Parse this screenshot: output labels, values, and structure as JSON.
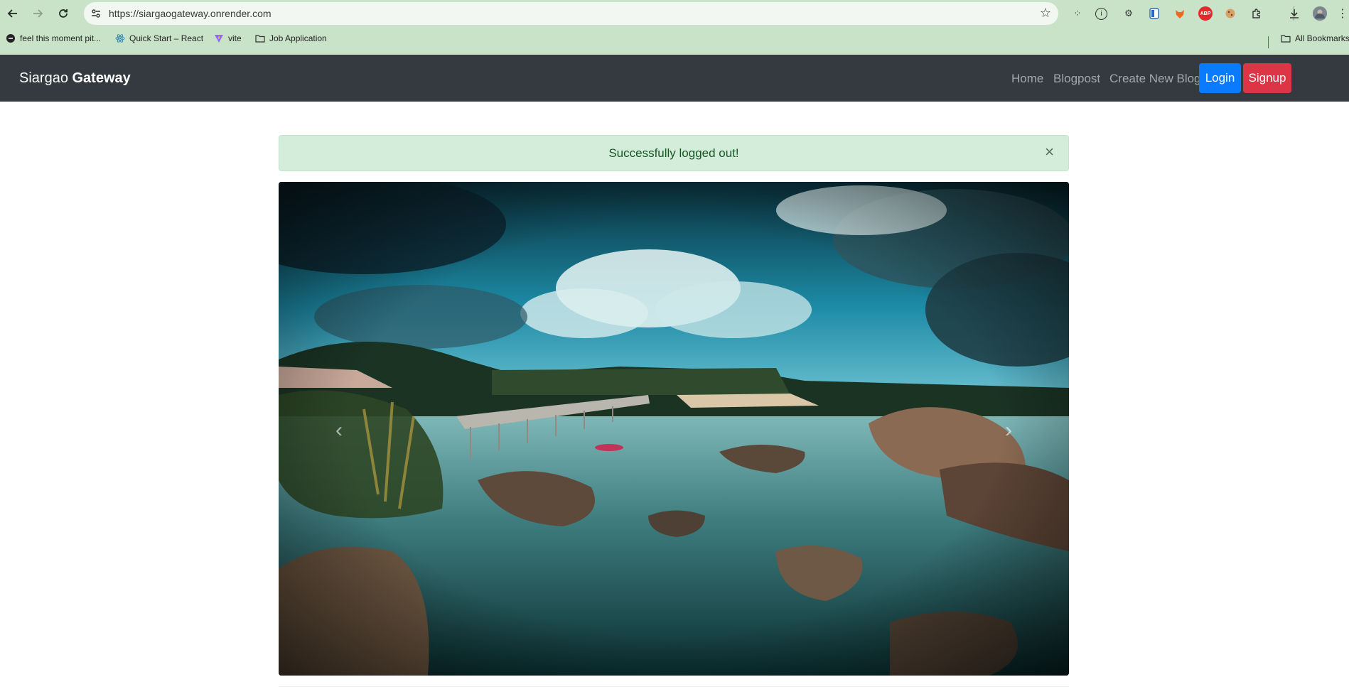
{
  "browser": {
    "url": "https://siargaogateway.onrender.com",
    "bookmarks": [
      {
        "label": "feel this moment pit...",
        "icon": "page-icon"
      },
      {
        "label": "Quick Start – React",
        "icon": "react-icon"
      },
      {
        "label": "vite",
        "icon": "vite-icon"
      },
      {
        "label": "Job Application",
        "icon": "folder-icon"
      }
    ],
    "all_bookmarks_label": "All Bookmarks"
  },
  "site": {
    "brand_first": "Siargao",
    "brand_second": "Gateway",
    "nav": {
      "home": "Home",
      "blogpost": "Blogpost",
      "create": "Create New Blog",
      "login": "Login",
      "signup": "Signup"
    },
    "colors": {
      "navbar": "#343a40",
      "login": "#0a7bff",
      "signup": "#dc3545",
      "alert_bg": "#d4edda",
      "alert_text": "#155724"
    }
  },
  "alert": {
    "message": "Successfully logged out!",
    "close_symbol": "×"
  },
  "carousel": {
    "prev_symbol": "‹",
    "next_symbol": "›"
  }
}
